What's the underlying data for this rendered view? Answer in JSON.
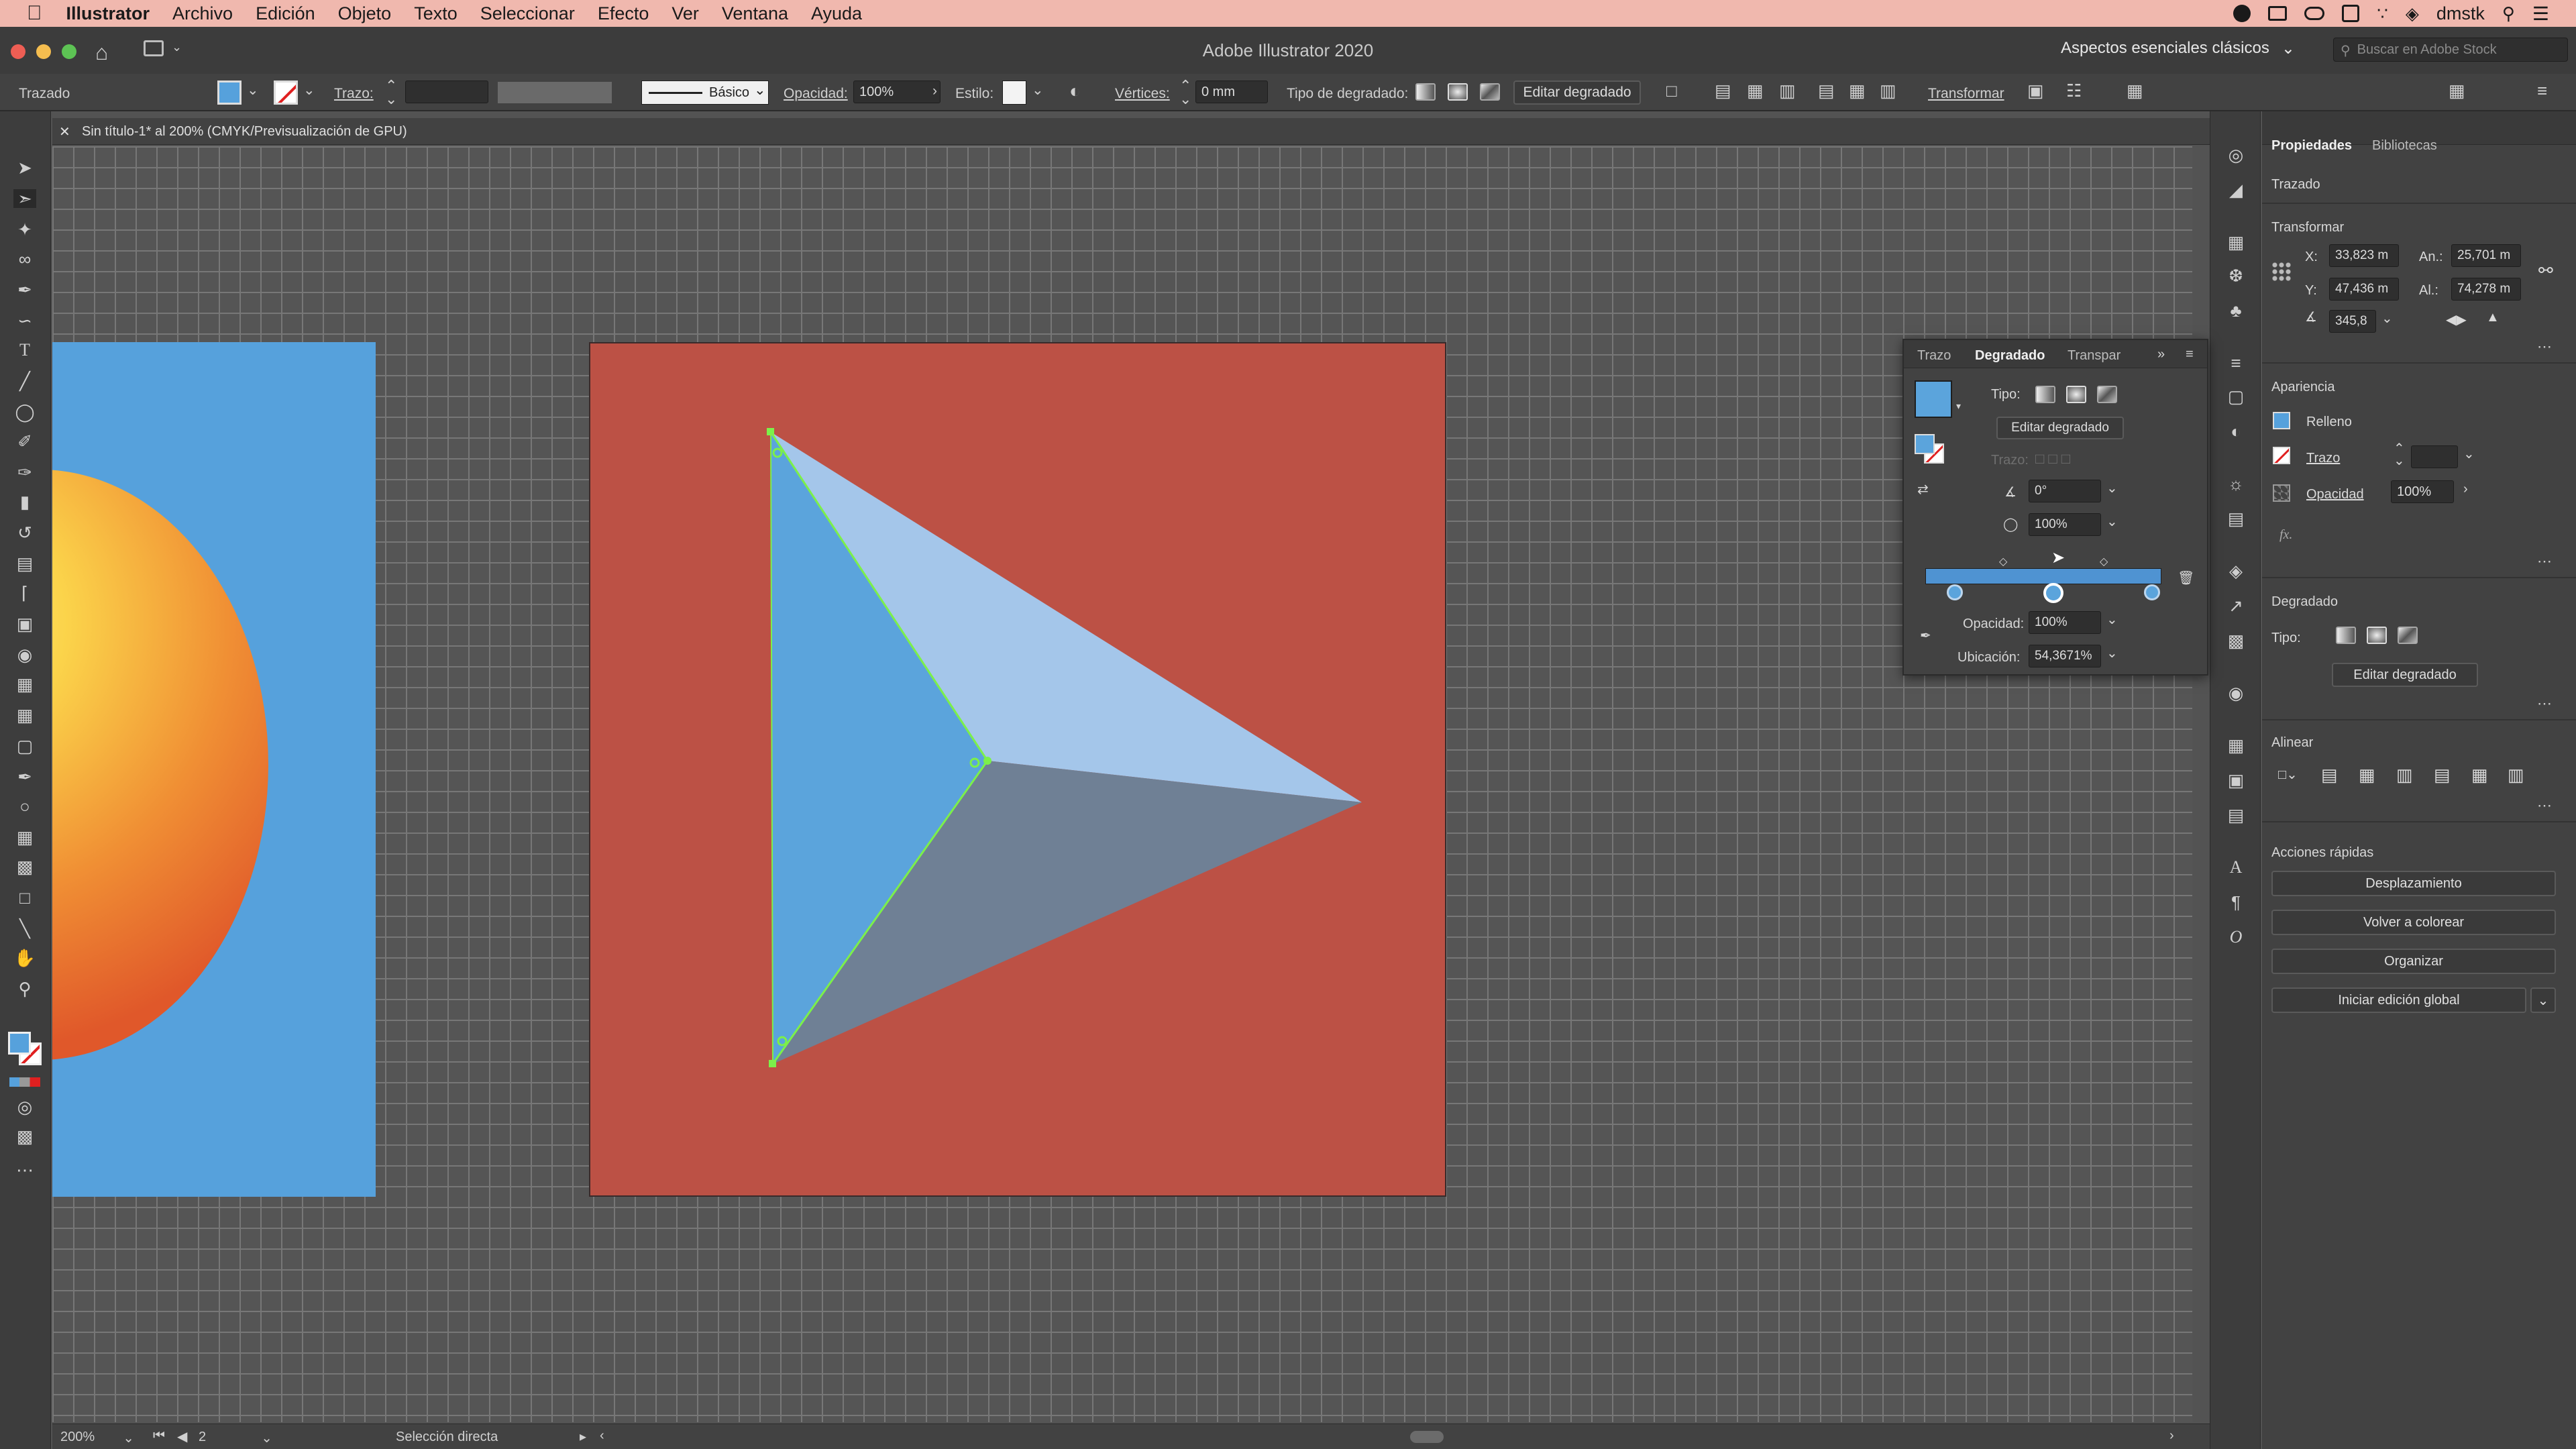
{
  "menubar": {
    "app_name": "Illustrator",
    "items": [
      "Archivo",
      "Edición",
      "Objeto",
      "Texto",
      "Seleccionar",
      "Efecto",
      "Ver",
      "Ventana",
      "Ayuda"
    ],
    "user": "dmstk"
  },
  "titlebar": {
    "title": "Adobe Illustrator 2020",
    "workspace": "Aspectos esenciales clásicos",
    "search_placeholder": "Buscar en Adobe Stock"
  },
  "control_bar": {
    "object_type": "Trazado",
    "stroke_label": "Trazo:",
    "brush": "Básico",
    "opacity_label": "Opacidad:",
    "opacity": "100%",
    "style_label": "Estilo:",
    "vertices_label": "Vértices:",
    "vertices_value": "0 mm",
    "gradient_type_label": "Tipo de degradado:",
    "edit_gradient": "Editar degradado",
    "transform": "Transformar"
  },
  "document_tab": {
    "title": "Sin título-1* al 200% (CMYK/Previsualización de GPU)"
  },
  "status_bar": {
    "zoom": "200%",
    "artboard": "2",
    "tool": "Selección directa"
  },
  "gradient_panel": {
    "tabs": [
      "Trazo",
      "Degradado",
      "Transpar"
    ],
    "type_label": "Tipo:",
    "edit_button": "Editar degradado",
    "stroke_label": "Trazo:",
    "angle": "0°",
    "aspect": "100%",
    "opacity_label": "Opacidad:",
    "opacity": "100%",
    "location_label": "Ubicación:",
    "location": "54,3671%",
    "colors": {
      "stop_a": "#5b9fd8",
      "stop_b": "#4f93d2"
    }
  },
  "properties": {
    "tabs": [
      "Propiedades",
      "Bibliotecas"
    ],
    "object_type": "Trazado",
    "transform": {
      "title": "Transformar",
      "x_label": "X:",
      "x": "33,823 m",
      "y_label": "Y:",
      "y": "47,436 m",
      "w_label": "An.:",
      "w": "25,701 m",
      "h_label": "Al.:",
      "h": "74,278 m",
      "angle": "345,8"
    },
    "appearance": {
      "title": "Apariencia",
      "fill_label": "Relleno",
      "stroke_label": "Trazo",
      "opacity_label": "Opacidad",
      "opacity": "100%",
      "fx": "fx."
    },
    "gradient": {
      "title": "Degradado",
      "type_label": "Tipo:",
      "edit_button": "Editar degradado"
    },
    "align": {
      "title": "Alinear"
    },
    "quick_actions": {
      "title": "Acciones rápidas",
      "buttons": [
        "Desplazamiento",
        "Volver a colorear",
        "Organizar",
        "Iniciar edición global"
      ]
    }
  },
  "artwork": {
    "colors": {
      "left_bg": "#56a1dc",
      "artboard": "#bc5145",
      "tri_left": "#5ba4dc",
      "tri_top": "#a4c6ea",
      "tri_bottom": "#6f8095",
      "selection": "#7cf04a"
    }
  }
}
